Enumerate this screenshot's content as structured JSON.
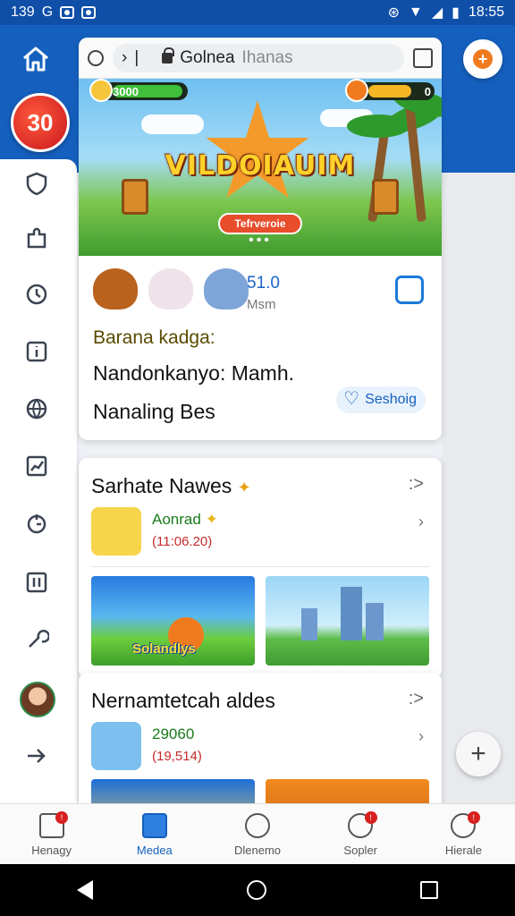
{
  "status_bar": {
    "time_left": "139",
    "g_label": "G",
    "time_right": "18:55"
  },
  "rail": {
    "badge": "30"
  },
  "browser": {
    "url_primary": "Golnea",
    "url_secondary": "Ihanas"
  },
  "banner": {
    "coins": "3000",
    "energy": "0",
    "game_title": "VILDOIAUIM",
    "play_label": "Tefrveroie",
    "pager": "•••"
  },
  "info": {
    "stat_value": "51.0",
    "stat_label": "Msm",
    "line1": "Barana kadga:",
    "line2": "Nandonkanyo: Mamh.",
    "line3": "Nanaling Bes",
    "subscribe_label": "Seshoig"
  },
  "section1": {
    "title": "Sarhate Nawes",
    "more": ":>",
    "item_title": "Aonrad",
    "item_sub": "(11:06.20)",
    "tile_label": "Solandlys"
  },
  "section2": {
    "title": "Nernamtetcah aldes",
    "more": ":>",
    "item_title": "29060",
    "item_sub": "(19,514)"
  },
  "bottom_nav": [
    {
      "label": "Henagy",
      "icon": "home-icon",
      "badge": "!"
    },
    {
      "label": "Medea",
      "icon": "grid-icon",
      "badge": ""
    },
    {
      "label": "Dlenemo",
      "icon": "compass-icon",
      "badge": ""
    },
    {
      "label": "Sopler",
      "icon": "chat-icon",
      "badge": "!"
    },
    {
      "label": "Hierale",
      "icon": "profile-icon",
      "badge": "!"
    }
  ],
  "colors": {
    "brand": "#1560bf",
    "accent": "#f07b1e",
    "badge": "#d8201f"
  }
}
